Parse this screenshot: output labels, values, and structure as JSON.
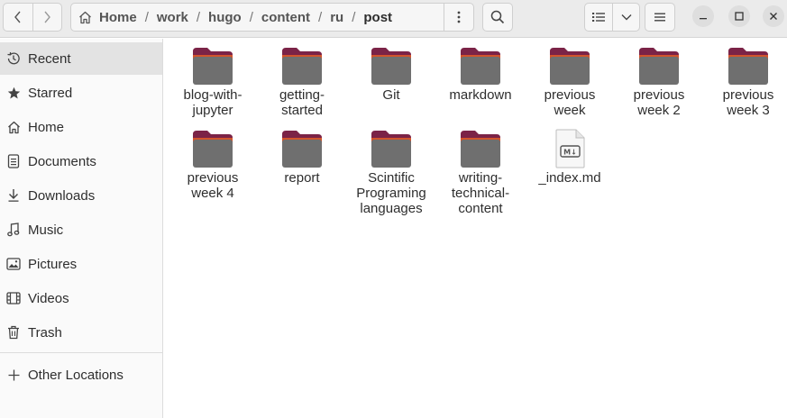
{
  "colors": {
    "folder_back": "#7b2347",
    "folder_tab": "#e25d28",
    "folder_front": "#6f6f6f",
    "sidebar_selected": "#e3e3e3"
  },
  "header": {
    "path": [
      "Home",
      "work",
      "hugo",
      "content",
      "ru",
      "post"
    ],
    "path_separator": "/",
    "icons": {
      "back": "chevron-left-icon",
      "forward": "chevron-right-icon",
      "home": "home-icon",
      "path_menu": "vertical-ellipsis-icon",
      "search": "search-icon",
      "view": "list-view-icon",
      "view_dropdown": "chevron-down-icon",
      "main_menu": "hamburger-menu-icon",
      "minimize": "minimize-icon",
      "maximize": "maximize-icon",
      "close": "close-icon"
    }
  },
  "sidebar": {
    "items": [
      {
        "label": "Recent",
        "icon": "clock-icon",
        "selected": true
      },
      {
        "label": "Starred",
        "icon": "star-icon"
      },
      {
        "label": "Home",
        "icon": "home-icon"
      },
      {
        "label": "Documents",
        "icon": "document-icon"
      },
      {
        "label": "Downloads",
        "icon": "download-icon"
      },
      {
        "label": "Music",
        "icon": "music-note-icon"
      },
      {
        "label": "Pictures",
        "icon": "picture-icon"
      },
      {
        "label": "Videos",
        "icon": "film-icon"
      },
      {
        "label": "Trash",
        "icon": "trash-icon"
      }
    ],
    "other_locations": {
      "label": "Other Locations",
      "icon": "plus-icon"
    }
  },
  "files": [
    {
      "name": "blog-with-jupyter",
      "lines": [
        "blog-with-",
        "jupyter"
      ],
      "kind": "folder"
    },
    {
      "name": "getting-started",
      "lines": [
        "getting-",
        "started"
      ],
      "kind": "folder"
    },
    {
      "name": "Git",
      "lines": [
        "Git"
      ],
      "kind": "folder"
    },
    {
      "name": "markdown",
      "lines": [
        "markdown"
      ],
      "kind": "folder"
    },
    {
      "name": "previous week",
      "lines": [
        "previous",
        "week"
      ],
      "kind": "folder"
    },
    {
      "name": "previous week 2",
      "lines": [
        "previous",
        "week 2"
      ],
      "kind": "folder"
    },
    {
      "name": "previous week 3",
      "lines": [
        "previous",
        "week 3"
      ],
      "kind": "folder"
    },
    {
      "name": "previous week 4",
      "lines": [
        "previous",
        "week 4"
      ],
      "kind": "folder"
    },
    {
      "name": "report",
      "lines": [
        "report"
      ],
      "kind": "folder"
    },
    {
      "name": "Scintific Programing languages",
      "lines": [
        "Scintific",
        "Programing",
        "languages"
      ],
      "kind": "folder"
    },
    {
      "name": "writing-technical-content",
      "lines": [
        "writing-",
        "technical-",
        "content"
      ],
      "kind": "folder"
    },
    {
      "name": "_index.md",
      "lines": [
        "_index.md"
      ],
      "kind": "markdown-file",
      "badge": "M↓"
    }
  ]
}
